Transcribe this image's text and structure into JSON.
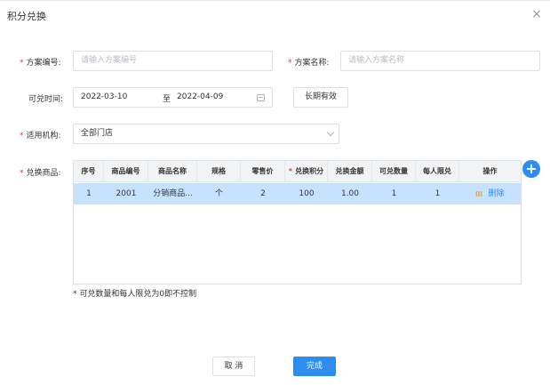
{
  "dialog": {
    "title": "积分兑换",
    "close_glyph": "×"
  },
  "form": {
    "scheme_no": {
      "label": "方案编号:",
      "placeholder": "请输入方案编号"
    },
    "scheme_name": {
      "label": "方案名称:",
      "placeholder": "请输入方案名称"
    },
    "period": {
      "label": "可兑时间:",
      "start": "2022-03-10",
      "separator": "至",
      "end": "2022-04-09",
      "long_term_button": "长期有效"
    },
    "org": {
      "label": "适用机构:",
      "value": "全部门店"
    },
    "goods": {
      "label": "兑换商品:"
    }
  },
  "table": {
    "columns": [
      "序号",
      "商品编号",
      "商品名称",
      "规格",
      "零售价",
      "兑换积分",
      "兑换金额",
      "可兑数量",
      "每人限兑",
      "操作"
    ],
    "rows": [
      [
        "1",
        "2001",
        "分销商品...",
        "个",
        "2",
        "100",
        "1.00",
        "1",
        "1"
      ]
    ],
    "row_action_delete": "删除"
  },
  "note": "* 可兑数量和每人限兑为0即不控制",
  "footer": {
    "cancel": "取 消",
    "confirm": "完成"
  },
  "colors": {
    "primary": "#2d8cf0",
    "required": "#e4393c",
    "selected_row": "#c6e2ff",
    "grid_icon": "#e6a23c"
  }
}
